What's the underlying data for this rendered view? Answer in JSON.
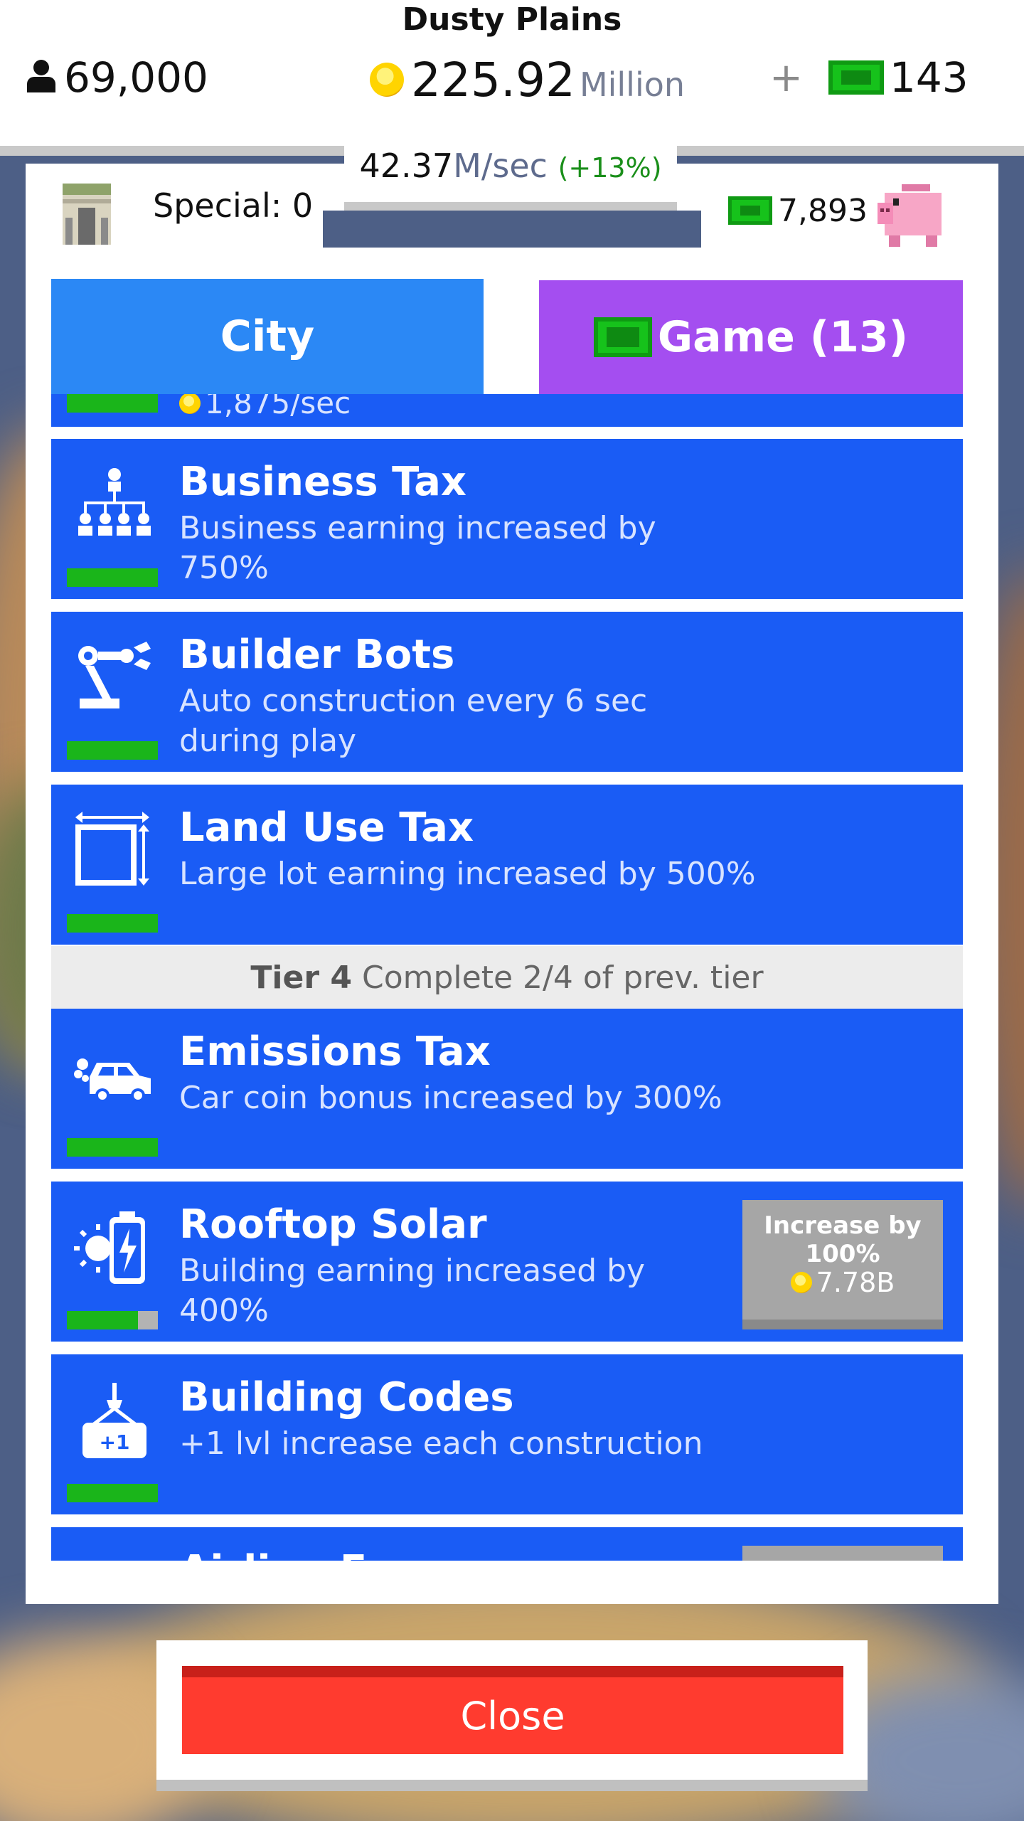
{
  "header": {
    "city_name": "Dusty Plains",
    "population": "69,000",
    "coins_value": "225.92",
    "coins_unit": "Million",
    "plus_symbol": "+",
    "cash": "143",
    "rate_value": "42.37",
    "rate_unit": "M/sec",
    "rate_bonus": "(+13%)"
  },
  "panel": {
    "special_label": "Special: 0",
    "bank_amount": "7,893"
  },
  "tabs": {
    "city": "City",
    "game": "Game (13)"
  },
  "list": {
    "partial_row_text": "1,875/sec",
    "items": [
      {
        "title": "Business Tax",
        "desc": "Business earning increased by 750%",
        "progress": 1.0,
        "icon": "org-chart-icon"
      },
      {
        "title": "Builder Bots",
        "desc": "Auto construction every 6 sec during play",
        "progress": 1.0,
        "icon": "robot-arm-icon"
      },
      {
        "title": "Land Use Tax",
        "desc": "Large lot earning increased by 500%",
        "progress": 1.0,
        "icon": "land-lot-icon"
      },
      {
        "title": "Emissions Tax",
        "desc": "Car coin bonus increased by 300%",
        "progress": 1.0,
        "icon": "car-emissions-icon"
      },
      {
        "title": "Rooftop Solar",
        "desc": "Building earning increased by 400%",
        "progress": 0.75,
        "icon": "solar-battery-icon"
      },
      {
        "title": "Building Codes",
        "desc": "+1 lvl increase each construction",
        "progress": 1.0,
        "icon": "crane-plus-icon"
      },
      {
        "title": "Airline Fees",
        "desc": "",
        "progress": 0,
        "icon": "airplane-icon"
      }
    ],
    "tier": {
      "label": "Tier 4",
      "text": "Complete 2/4 of prev. tier"
    },
    "buy_button": {
      "line1": "Increase by",
      "line2": "100%",
      "price": "7.78B"
    }
  },
  "footer": {
    "close_label": "Close"
  },
  "colors": {
    "row_blue": "#1a5cf5",
    "city_tab": "#2b88f5",
    "game_tab": "#a44ef0",
    "close_red": "#ff3b2f",
    "progress_green": "#1ab51a"
  }
}
